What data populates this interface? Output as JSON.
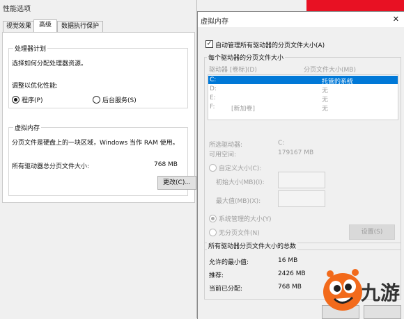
{
  "bg_window": {
    "title": "性能选项",
    "tabs": [
      {
        "label": "视觉效果"
      },
      {
        "label": "高级"
      },
      {
        "label": "数据执行保护"
      }
    ],
    "processor": {
      "group_label": "处理器计划",
      "desc": "选择如何分配处理器资源。",
      "adjust_label": "调整以优化性能:",
      "option_programs": "程序(P)",
      "option_background": "后台服务(S)",
      "selected": "programs"
    },
    "vm": {
      "group_label": "虚拟内存",
      "desc": "分页文件是硬盘上的一块区域，Windows 当作 RAM 使用。",
      "total_label": "所有驱动器总分页文件大小:",
      "total_value": "768 MB",
      "change_button": "更改(C)..."
    }
  },
  "dialog": {
    "title": "虚拟内存",
    "close_glyph": "✕",
    "auto_manage_label": "自动管理所有驱动器的分页文件大小(A)",
    "auto_manage_checked": true,
    "per_drive_group": "每个驱动器的分页文件大小",
    "drive_header": "驱动器 [卷标](D)",
    "size_header": "分页文件大小(MB)",
    "drives": [
      {
        "drive": "C:",
        "label": "",
        "size": "托管的系统",
        "selected": true
      },
      {
        "drive": "D:",
        "label": "",
        "size": "无",
        "selected": false
      },
      {
        "drive": "E:",
        "label": "",
        "size": "无",
        "selected": false
      },
      {
        "drive": "F:",
        "label": "[新加卷]",
        "size": "无",
        "selected": false
      }
    ],
    "selected_drive_label": "所选驱动器:",
    "selected_drive_value": "C:",
    "free_space_label": "可用空间:",
    "free_space_value": "179167 MB",
    "custom_size_label": "自定义大小(C):",
    "initial_size_label": "初始大小(MB)(I):",
    "max_size_label": "最大值(MB)(X):",
    "system_managed_label": "系统管理的大小(Y)",
    "no_paging_label": "无分页文件(N)",
    "set_button": "设置(S)",
    "total_group": "所有驱动器分页文件大小的总数",
    "min_label": "允许的最小值:",
    "min_value": "16 MB",
    "recommended_label": "推荐:",
    "recommended_value": "2426 MB",
    "current_label": "当前已分配:",
    "current_value": "768 MB"
  },
  "watermark": {
    "brand": "九游"
  },
  "colors": {
    "selection": "#0078d7",
    "desktop_red": "#e81123",
    "logo_orange": "#f26a1b"
  }
}
